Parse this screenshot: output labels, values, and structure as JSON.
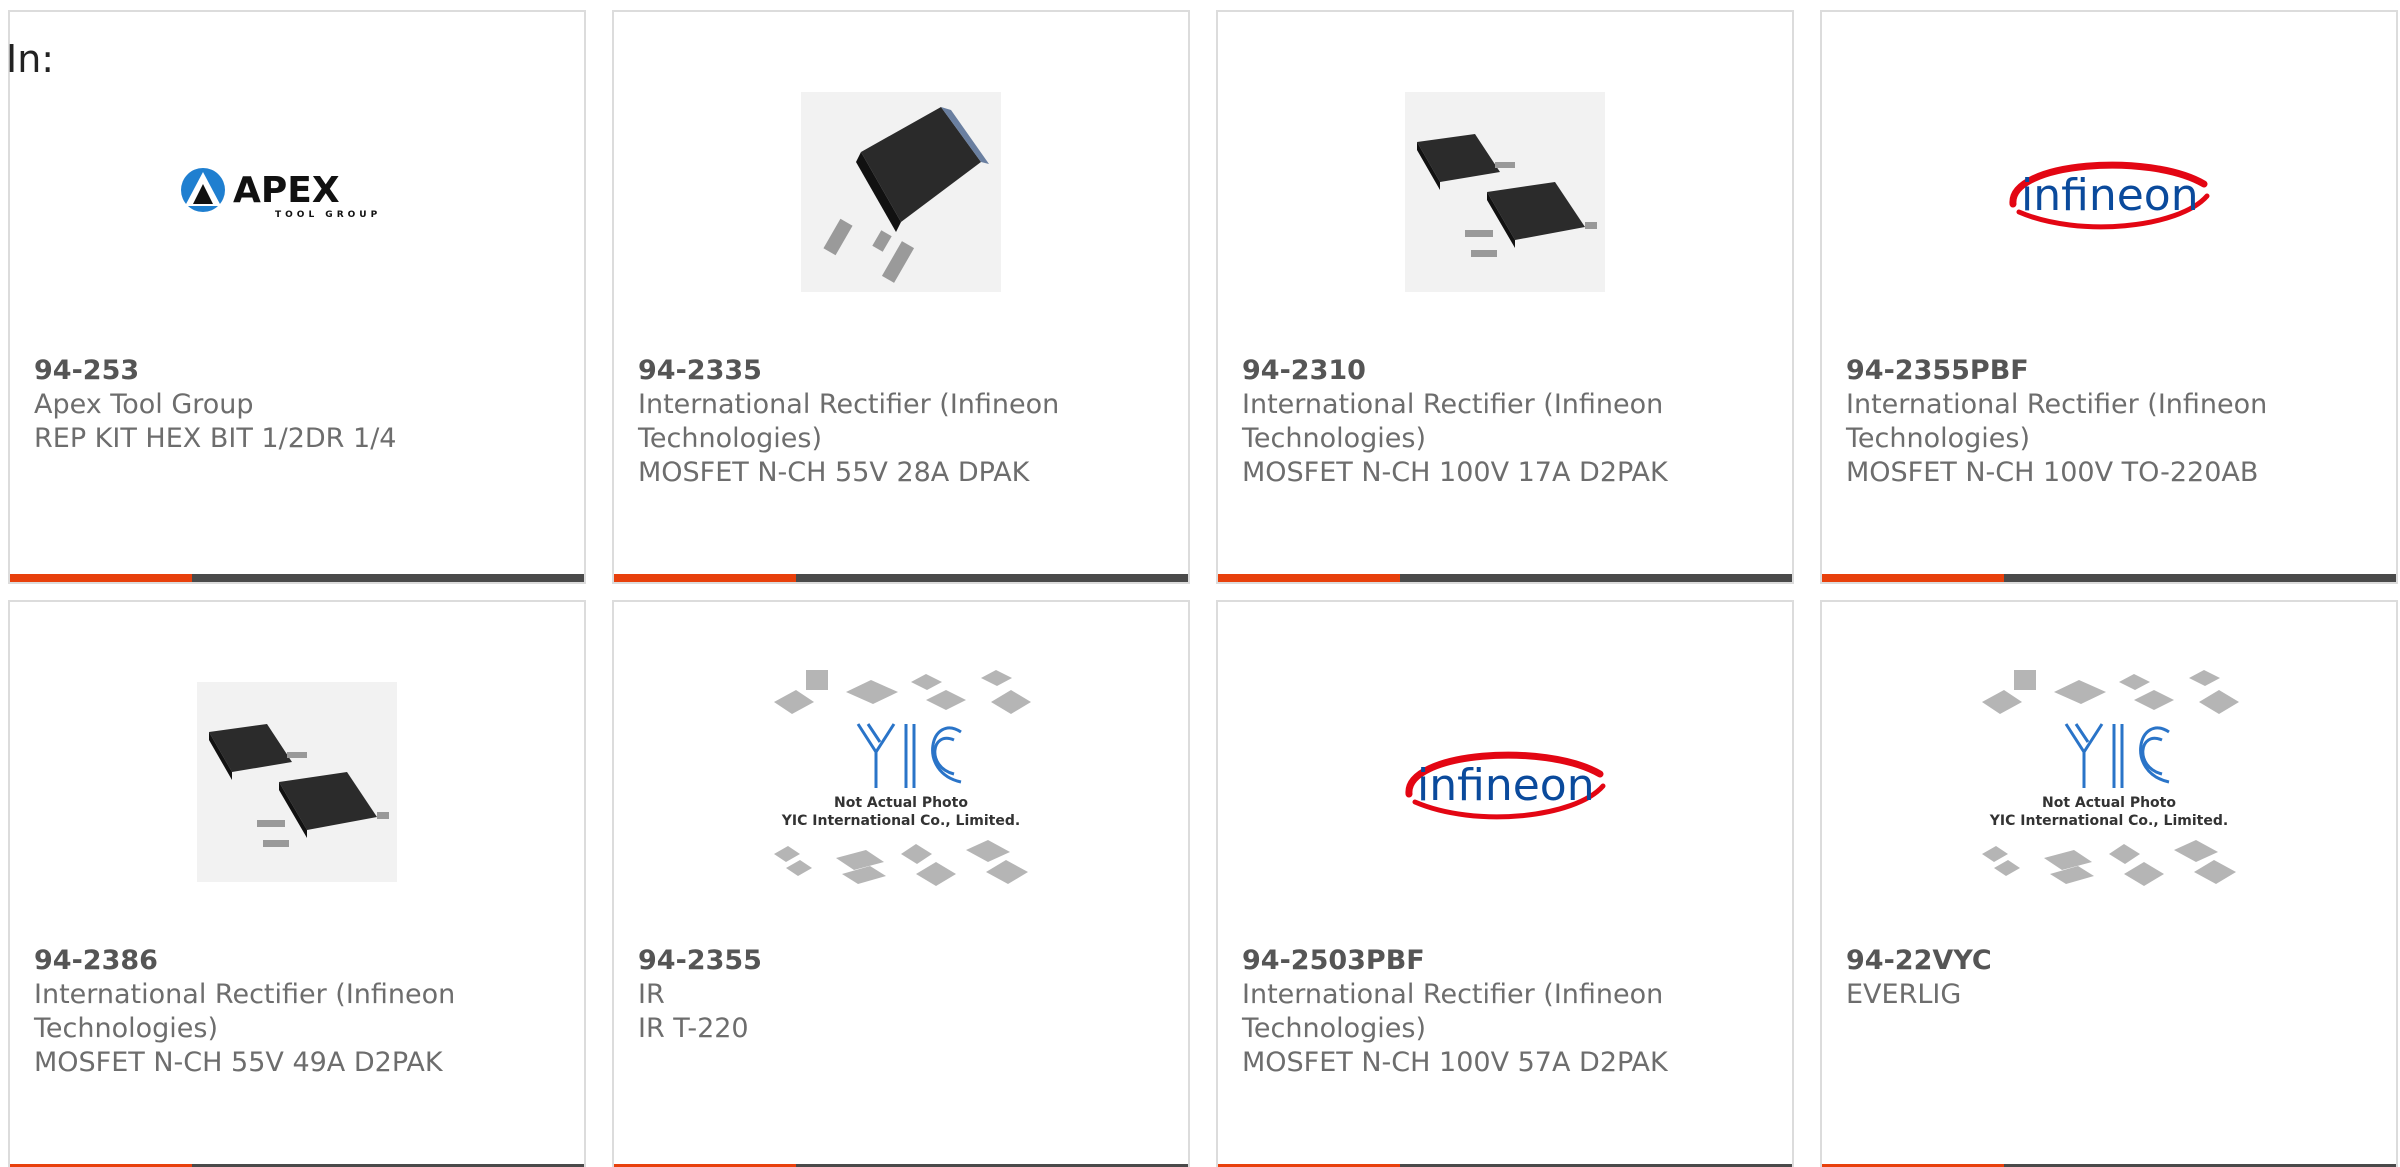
{
  "header": {
    "label": "In:"
  },
  "products": [
    {
      "part_number": "94-253",
      "manufacturer": "Apex Tool Group",
      "description": "REP KIT HEX BIT 1/2DR 1/4",
      "image": "apex-tool-group-logo",
      "logo_text": "APEX",
      "logo_subtext": "TOOL GROUP"
    },
    {
      "part_number": "94-2335",
      "manufacturer": "International Rectifier (Infineon Technologies)",
      "description": "MOSFET N-CH 55V 28A DPAK",
      "image": "dpak-package-photo"
    },
    {
      "part_number": "94-2310",
      "manufacturer": "International Rectifier (Infineon Technologies)",
      "description": "MOSFET N-CH 100V 17A D2PAK",
      "image": "d2pak-package-photo"
    },
    {
      "part_number": "94-2355PBF",
      "manufacturer": "International Rectifier (Infineon Technologies)",
      "description": "MOSFET N-CH 100V TO-220AB",
      "image": "infineon-logo",
      "logo_text": "infineon"
    },
    {
      "part_number": "94-2386",
      "manufacturer": "International Rectifier (Infineon Technologies)",
      "description": "MOSFET N-CH 55V 49A D2PAK",
      "image": "d2pak-package-photo"
    },
    {
      "part_number": "94-2355",
      "manufacturer": "IR",
      "description": "IR T-220",
      "image": "yic-placeholder",
      "placeholder_line1": "Not Actual Photo",
      "placeholder_line2": "YIC International Co., Limited."
    },
    {
      "part_number": "94-2503PBF",
      "manufacturer": "International Rectifier (Infineon Technologies)",
      "description": "MOSFET N-CH 100V 57A D2PAK",
      "image": "infineon-logo",
      "logo_text": "infineon"
    },
    {
      "part_number": "94-22VYC",
      "manufacturer": "EVERLIG",
      "description": "",
      "image": "yic-placeholder",
      "placeholder_line1": "Not Actual Photo",
      "placeholder_line2": "YIC International Co., Limited."
    }
  ],
  "colors": {
    "accent": "#e8400c",
    "bar": "#4a4a4a",
    "infineon_red": "#e30613",
    "infineon_blue": "#0a4a9c",
    "yic_blue": "#2a74c8"
  }
}
